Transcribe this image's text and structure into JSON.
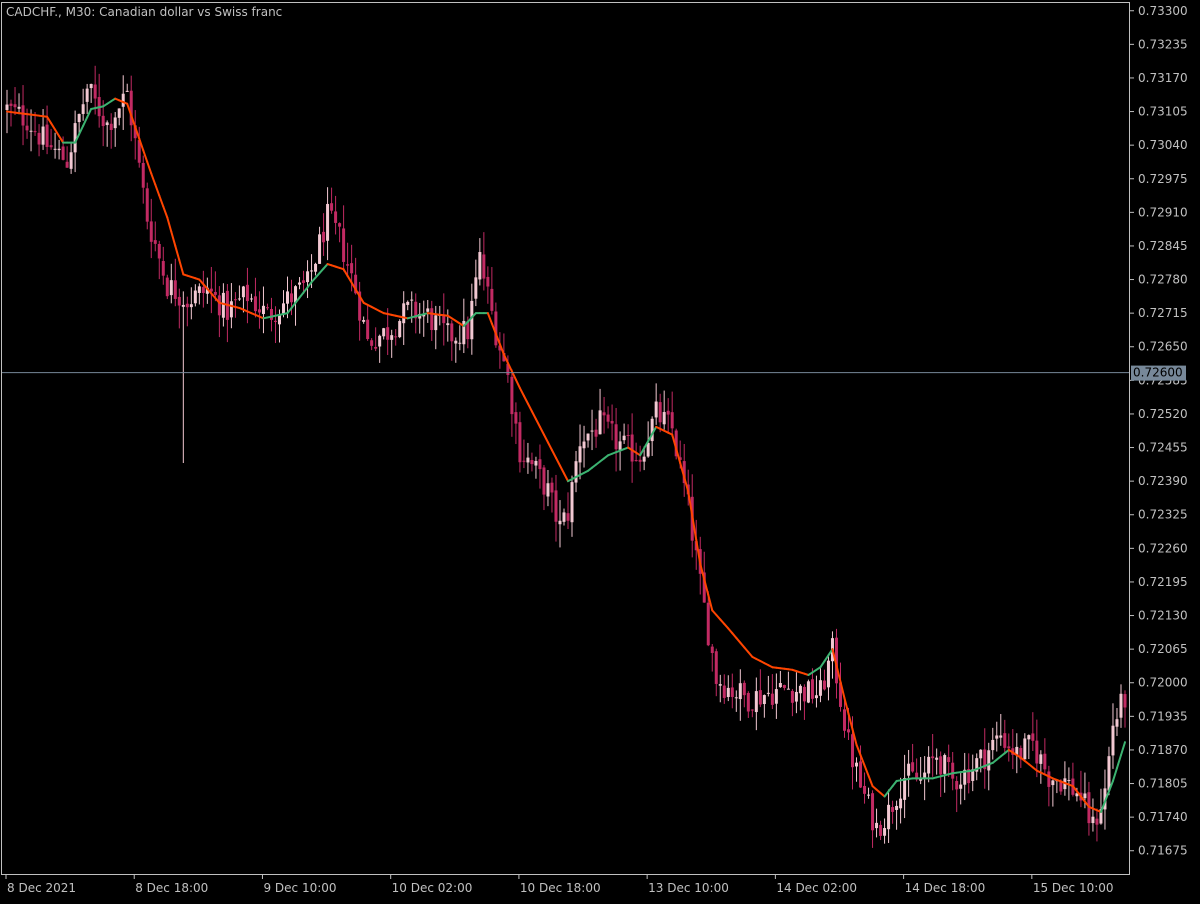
{
  "header": {
    "symbol": "CADCHF.",
    "timeframe": "M30",
    "description": "Canadian dollar vs Swiss franc"
  },
  "colors": {
    "background": "#000000",
    "foreground": "#C0C0C0",
    "bear_candle": "#C22A63",
    "bull_candle": "#F2C8D2",
    "ma_falling": "#FF4500",
    "ma_rising": "#3CB371",
    "price_line": "#778899",
    "price_label_bg": "#778899",
    "price_label_text": "#000000"
  },
  "price_line": {
    "value": 0.726,
    "label": "0.72600"
  },
  "chart_data": {
    "type": "candlestick",
    "title": "CADCHF., M30: Canadian dollar vs Swiss franc",
    "ylim": [
      0.7163,
      0.73315
    ],
    "y_ticks": [
      "0.73300",
      "0.73235",
      "0.73170",
      "0.73105",
      "0.73040",
      "0.72975",
      "0.72910",
      "0.72845",
      "0.72780",
      "0.72715",
      "0.72650",
      "0.72585",
      "0.72520",
      "0.72455",
      "0.72390",
      "0.72325",
      "0.72260",
      "0.72195",
      "0.72130",
      "0.72065",
      "0.72000",
      "0.71935",
      "0.71870",
      "0.71805",
      "0.71740",
      "0.71675"
    ],
    "x_ticks": [
      {
        "label": "8 Dec 2021",
        "index": 0
      },
      {
        "label": "8 Dec 18:00",
        "index": 32
      },
      {
        "label": "9 Dec 10:00",
        "index": 64
      },
      {
        "label": "10 Dec 02:00",
        "index": 96
      },
      {
        "label": "10 Dec 18:00",
        "index": 128
      },
      {
        "label": "13 Dec 10:00",
        "index": 160
      },
      {
        "label": "14 Dec 02:00",
        "index": 192
      },
      {
        "label": "14 Dec 18:00",
        "index": 224
      },
      {
        "label": "15 Dec 10:00",
        "index": 256
      }
    ],
    "bar_count": 280,
    "closes": [
      [
        0,
        0.7311
      ],
      [
        5,
        0.7309
      ],
      [
        10,
        0.7304
      ],
      [
        15,
        0.7301
      ],
      [
        20,
        0.7315
      ],
      [
        25,
        0.7308
      ],
      [
        30,
        0.7314
      ],
      [
        35,
        0.729
      ],
      [
        40,
        0.7277
      ],
      [
        45,
        0.7274
      ],
      [
        50,
        0.7276
      ],
      [
        55,
        0.7272
      ],
      [
        60,
        0.7275
      ],
      [
        65,
        0.7271
      ],
      [
        70,
        0.7274
      ],
      [
        75,
        0.7277
      ],
      [
        80,
        0.729
      ],
      [
        83,
        0.7286
      ],
      [
        87,
        0.7276
      ],
      [
        90,
        0.7266
      ],
      [
        95,
        0.7268
      ],
      [
        100,
        0.7272
      ],
      [
        105,
        0.7271
      ],
      [
        110,
        0.7267
      ],
      [
        115,
        0.7268
      ],
      [
        118,
        0.7282
      ],
      [
        122,
        0.7268
      ],
      [
        125,
        0.7259
      ],
      [
        128,
        0.7245
      ],
      [
        132,
        0.7241
      ],
      [
        135,
        0.7237
      ],
      [
        138,
        0.723
      ],
      [
        140,
        0.7233
      ],
      [
        143,
        0.7247
      ],
      [
        148,
        0.725
      ],
      [
        153,
        0.7246
      ],
      [
        158,
        0.7244
      ],
      [
        162,
        0.7252
      ],
      [
        166,
        0.7249
      ],
      [
        170,
        0.7234
      ],
      [
        173,
        0.7219
      ],
      [
        177,
        0.7201
      ],
      [
        180,
        0.7199
      ],
      [
        185,
        0.7197
      ],
      [
        190,
        0.7198
      ],
      [
        195,
        0.7199
      ],
      [
        200,
        0.7198
      ],
      [
        203,
        0.7198
      ],
      [
        206,
        0.7206
      ],
      [
        208,
        0.7197
      ],
      [
        210,
        0.7188
      ],
      [
        213,
        0.718
      ],
      [
        217,
        0.7172
      ],
      [
        220,
        0.7175
      ],
      [
        224,
        0.7182
      ],
      [
        228,
        0.7181
      ],
      [
        232,
        0.7186
      ],
      [
        236,
        0.7181
      ],
      [
        240,
        0.7183
      ],
      [
        244,
        0.7186
      ],
      [
        248,
        0.719
      ],
      [
        252,
        0.7186
      ],
      [
        256,
        0.7188
      ],
      [
        260,
        0.7182
      ],
      [
        264,
        0.7181
      ],
      [
        268,
        0.7178
      ],
      [
        271,
        0.7172
      ],
      [
        274,
        0.7179
      ],
      [
        276,
        0.7192
      ],
      [
        279,
        0.7197
      ]
    ],
    "moving_average": [
      [
        0,
        0.73105
      ],
      [
        10,
        0.73095
      ],
      [
        14,
        0.73045
      ],
      [
        17,
        0.73045
      ],
      [
        21,
        0.7311
      ],
      [
        24,
        0.73115
      ],
      [
        27,
        0.7313
      ],
      [
        30,
        0.7312
      ],
      [
        36,
        0.72985
      ],
      [
        40,
        0.729
      ],
      [
        44,
        0.7279
      ],
      [
        48,
        0.7278
      ],
      [
        53,
        0.72735
      ],
      [
        58,
        0.72725
      ],
      [
        64,
        0.72705
      ],
      [
        70,
        0.72715
      ],
      [
        76,
        0.72775
      ],
      [
        80,
        0.7281
      ],
      [
        84,
        0.728
      ],
      [
        89,
        0.72735
      ],
      [
        94,
        0.72715
      ],
      [
        100,
        0.72705
      ],
      [
        105,
        0.72715
      ],
      [
        110,
        0.7271
      ],
      [
        114,
        0.7269
      ],
      [
        117,
        0.72715
      ],
      [
        120,
        0.72715
      ],
      [
        124,
        0.72635
      ],
      [
        128,
        0.7257
      ],
      [
        132,
        0.7251
      ],
      [
        136,
        0.7245
      ],
      [
        140,
        0.7239
      ],
      [
        145,
        0.7241
      ],
      [
        150,
        0.7244
      ],
      [
        155,
        0.72455
      ],
      [
        158,
        0.7244
      ],
      [
        162,
        0.72495
      ],
      [
        166,
        0.7248
      ],
      [
        170,
        0.7237
      ],
      [
        173,
        0.7223
      ],
      [
        176,
        0.7214
      ],
      [
        180,
        0.72105
      ],
      [
        186,
        0.7205
      ],
      [
        191,
        0.7203
      ],
      [
        196,
        0.72025
      ],
      [
        200,
        0.72015
      ],
      [
        203,
        0.7203
      ],
      [
        206,
        0.72065
      ],
      [
        209,
        0.7197
      ],
      [
        212,
        0.7188
      ],
      [
        216,
        0.718
      ],
      [
        219,
        0.7178
      ],
      [
        222,
        0.7181
      ],
      [
        226,
        0.71815
      ],
      [
        231,
        0.71815
      ],
      [
        236,
        0.71825
      ],
      [
        241,
        0.7183
      ],
      [
        246,
        0.71845
      ],
      [
        250,
        0.7187
      ],
      [
        253,
        0.71855
      ],
      [
        257,
        0.7183
      ],
      [
        261,
        0.71815
      ],
      [
        266,
        0.718
      ],
      [
        270,
        0.7176
      ],
      [
        273,
        0.7175
      ],
      [
        276,
        0.7181
      ],
      [
        279,
        0.71885
      ]
    ],
    "spike": {
      "index": 44,
      "low": 0.72425
    }
  }
}
